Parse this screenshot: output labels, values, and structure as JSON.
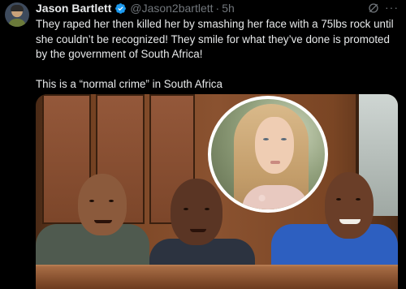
{
  "post": {
    "author": {
      "display_name": "Jason Bartlett",
      "handle": "@Jason2bartlett",
      "separator": "·",
      "time": "5h"
    },
    "actions": {
      "grok_icon": "grok-icon",
      "more_label": "···"
    },
    "text": {
      "paragraph_1": "They raped her then killed her by smashing her face with a 75lbs rock until she couldn’t be recognized! They smile for what they’ve done is promoted by the government of South Africa!",
      "paragraph_2": "This is a “normal crime” in South Africa"
    }
  },
  "colors": {
    "background": "#000000",
    "text_primary": "#e7e9ea",
    "text_secondary": "#71767b",
    "verified_blue": "#1d9bf0"
  }
}
